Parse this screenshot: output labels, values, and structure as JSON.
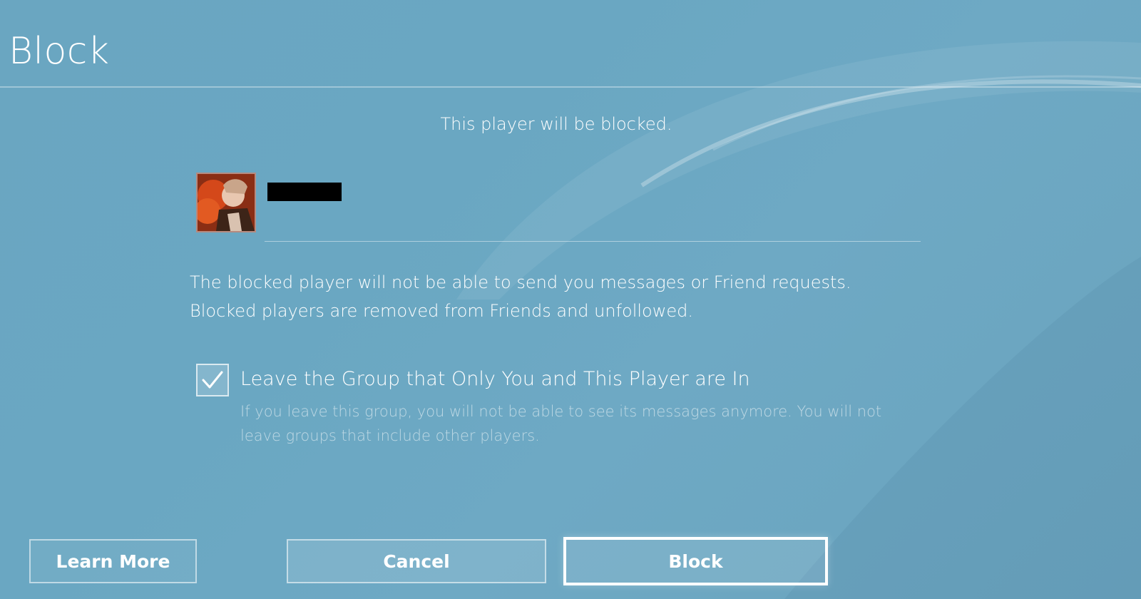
{
  "dialog": {
    "title": "Block",
    "subtitle": "This player will be blocked."
  },
  "player": {
    "name": ""
  },
  "info": {
    "line1": "The blocked player will not be able to send you messages or Friend requests.",
    "line2": "Blocked players are removed from Friends and unfollowed."
  },
  "leave_group": {
    "checked": true,
    "label": "Leave the Group that Only You and This Player are In",
    "description": "If you leave this group, you will not be able to see its messages anymore. You will not leave groups that include other players."
  },
  "buttons": {
    "learn_more": "Learn More",
    "cancel": "Cancel",
    "block": "Block"
  },
  "colors": {
    "background": "#6aa7c2",
    "text": "#ffffff"
  },
  "icons": {
    "checkbox": "checkmark-icon",
    "avatar": "user-avatar"
  }
}
